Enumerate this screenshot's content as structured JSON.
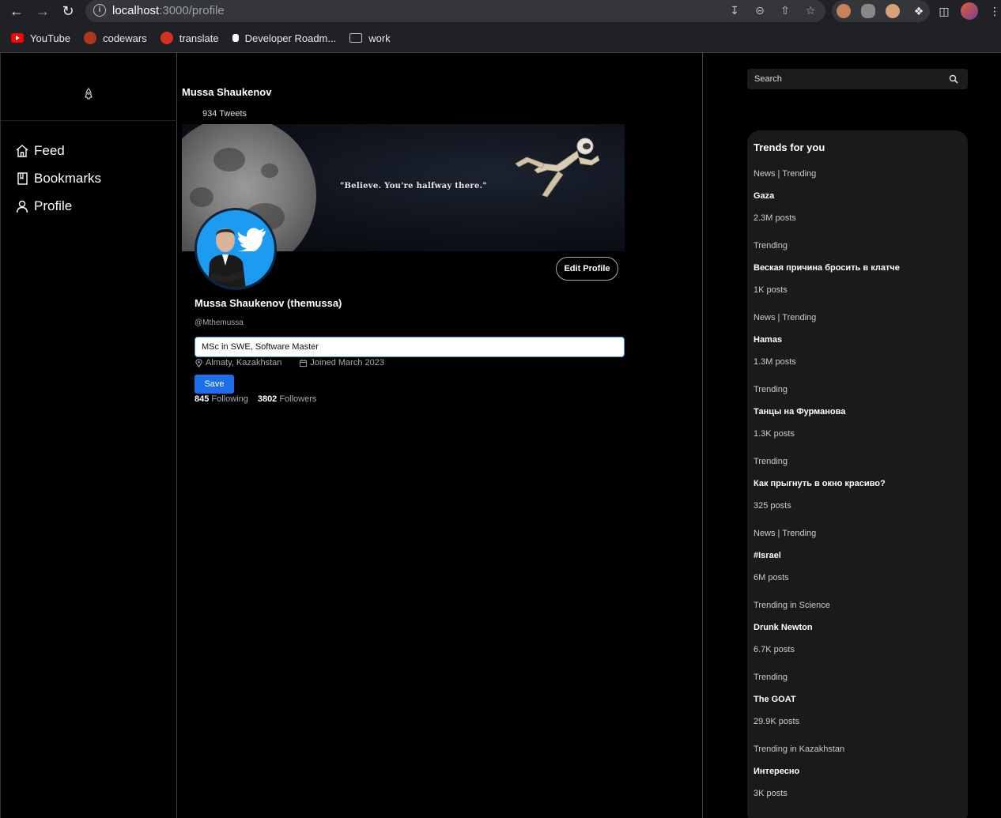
{
  "browser": {
    "url_host": "localhost",
    "url_path": ":3000/profile",
    "bookmarks": [
      {
        "label": "YouTube",
        "icon": "youtube-icon"
      },
      {
        "label": "codewars",
        "icon": "codewars-icon"
      },
      {
        "label": "translate",
        "icon": "translate-icon"
      },
      {
        "label": "Developer Roadm...",
        "icon": "roadmap-icon"
      },
      {
        "label": "work",
        "icon": "folder-icon"
      }
    ]
  },
  "sidebar": {
    "items": [
      {
        "label": "Feed",
        "icon": "home-icon"
      },
      {
        "label": "Bookmarks",
        "icon": "bookmark-icon"
      },
      {
        "label": "Profile",
        "icon": "user-icon"
      }
    ]
  },
  "profile": {
    "header_name": "Mussa Shaukenov",
    "tweet_count": "934 Tweets",
    "banner_quote": "\"Believe. You're halfway there.\"",
    "edit_button": "Edit Profile",
    "full_name": "Mussa Shaukenov (themussa)",
    "handle": "@Mthemussa",
    "bio_value": "MSc in SWE, Software Master",
    "location": "Almaty, Kazakhstan",
    "joined": "Joined March 2023",
    "save_button": "Save",
    "following_count": "845",
    "following_label": "Following",
    "followers_count": "3802",
    "followers_label": "Followers"
  },
  "search": {
    "placeholder": "Search"
  },
  "trends": {
    "title": "Trends for you",
    "items": [
      {
        "category": "News | Trending",
        "topic": "Gaza",
        "posts": "2.3M posts"
      },
      {
        "category": "Trending",
        "topic": "Веская причина бросить в клатче",
        "posts": "1K posts"
      },
      {
        "category": "News | Trending",
        "topic": "Hamas",
        "posts": "1.3M posts"
      },
      {
        "category": "Trending",
        "topic": "Танцы на Фурманова",
        "posts": "1.3K posts"
      },
      {
        "category": "Trending",
        "topic": "Как прыгнуть в окно красиво?",
        "posts": "325 posts"
      },
      {
        "category": "News | Trending",
        "topic": "#Israel",
        "posts": "6M posts"
      },
      {
        "category": "Trending in Science",
        "topic": "Drunk Newton",
        "posts": "6.7K posts"
      },
      {
        "category": "Trending",
        "topic": "The GOAT",
        "posts": "29.9K posts"
      },
      {
        "category": "Trending in Kazakhstan",
        "topic": "Интересно",
        "posts": "3K posts"
      }
    ]
  }
}
